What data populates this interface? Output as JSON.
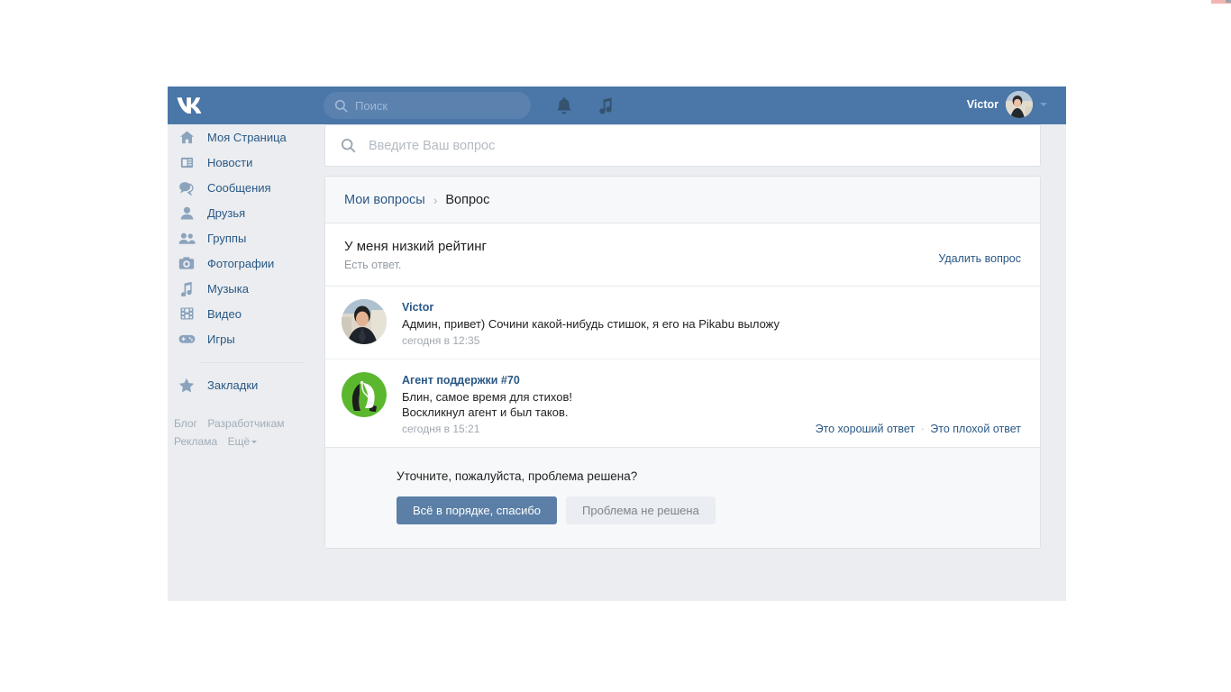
{
  "header": {
    "logo": "vk-logo",
    "search_placeholder": "Поиск",
    "search_value": "",
    "bell_icon": "bell-icon",
    "music_icon": "music-note-icon",
    "user_name": "Victor"
  },
  "sidebar": {
    "items": [
      {
        "icon": "home-icon",
        "label": "Моя Страница"
      },
      {
        "icon": "news-icon",
        "label": "Новости"
      },
      {
        "icon": "messages-icon",
        "label": "Сообщения"
      },
      {
        "icon": "friend-icon",
        "label": "Друзья"
      },
      {
        "icon": "groups-icon",
        "label": "Группы"
      },
      {
        "icon": "camera-icon",
        "label": "Фотографии"
      },
      {
        "icon": "music-icon",
        "label": "Музыка"
      },
      {
        "icon": "video-icon",
        "label": "Видео"
      },
      {
        "icon": "games-icon",
        "label": "Игры"
      }
    ],
    "bookmarks": {
      "icon": "star-icon",
      "label": "Закладки"
    },
    "footer_links": [
      "Блог",
      "Разработчикам",
      "Реклама",
      "Ещё"
    ]
  },
  "main": {
    "question_search_placeholder": "Введите Ваш вопрос",
    "question_search_value": "",
    "breadcrumb": {
      "parent": "Мои вопросы",
      "separator": "›",
      "current": "Вопрос"
    },
    "question": {
      "title": "У меня низкий рейтинг",
      "status": "Есть ответ.",
      "delete_label": "Удалить вопрос"
    },
    "messages": [
      {
        "author": "Victor",
        "avatar": "user-photo-avatar",
        "text": "Админ, привет) Сочини какой-нибудь стишок, я его на Pikabu выложу",
        "time": "сегодня в 12:35"
      },
      {
        "author": "Агент поддержки #70",
        "avatar": "support-agent-avatar",
        "text_line1": "Блин, самое время для стихов!",
        "text_line2": "Воскликнул агент и был таков.",
        "time": "сегодня в 15:21",
        "rate_good": "Это хороший ответ",
        "rate_separator": "·",
        "rate_bad": "Это плохой ответ"
      }
    ],
    "resolve": {
      "prompt": "Уточните, пожалуйста, проблема решена?",
      "confirm_label": "Всё в порядке, спасибо",
      "deny_label": "Проблема не решена"
    }
  },
  "colors": {
    "header_blue": "#4a76a8",
    "page_bg": "#ebedf0",
    "link_blue": "#2a5885",
    "primary_button": "#5b7fa6",
    "secondary_button": "#eaedf1",
    "agent_avatar_green": "#5bb82e"
  }
}
